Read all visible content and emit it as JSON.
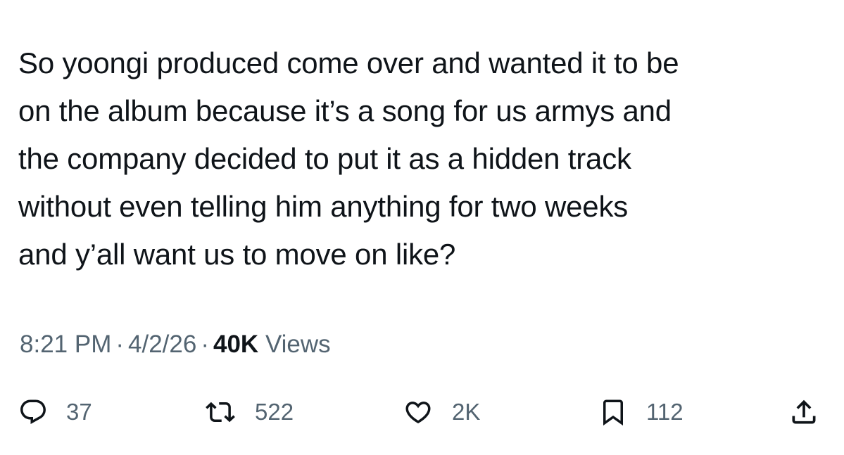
{
  "tweet": {
    "text_lines": [
      "So yoongi produced come over and wanted it to be",
      "on the album because it’s a song for us armys and",
      "the company decided to put it as a hidden track",
      "without even telling him anything for two weeks",
      "and y’all want us to move on like?"
    ]
  },
  "meta": {
    "time": "8:21 PM",
    "separator": "·",
    "date": "4/2/26",
    "views_count": "40K",
    "views_label": "Views"
  },
  "actions": {
    "reply": {
      "icon": "reply-icon",
      "count": "37"
    },
    "repost": {
      "icon": "repost-icon",
      "count": "522"
    },
    "like": {
      "icon": "heart-icon",
      "count": "2K"
    },
    "bookmark": {
      "icon": "bookmark-icon",
      "count": "112"
    },
    "share": {
      "icon": "share-icon"
    }
  },
  "colors": {
    "text": "#0f1419",
    "secondary": "#536471",
    "background": "#ffffff"
  }
}
